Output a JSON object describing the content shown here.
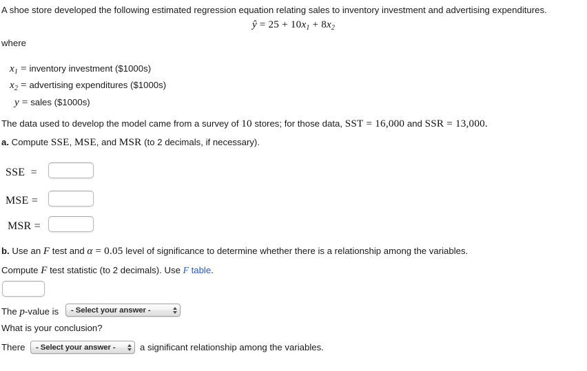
{
  "intro": {
    "prompt": "A shoe store developed the following estimated regression equation relating sales to inventory investment and advertising expenditures.",
    "equation": {
      "lhs": "ŷ",
      "eq": "=",
      "rhs_const": "25",
      "plus1": "+",
      "coef1": "10",
      "var1": "x",
      "sub1": "1",
      "plus2": "+",
      "coef2": "8",
      "var2": "x",
      "sub2": "2",
      "full": "ŷ = 25 + 10x₁ + 8x₂"
    },
    "where_label": "where"
  },
  "definitions": [
    {
      "symbol": "x",
      "subscript": "1",
      "eq": "=",
      "text": "inventory investment ($1000s)"
    },
    {
      "symbol": "x",
      "subscript": "2",
      "eq": "=",
      "text": "advertising expenditures ($1000s)"
    },
    {
      "symbol": "y",
      "subscript": "",
      "eq": "=",
      "text": "sales ($1000s)"
    }
  ],
  "data_sentence": {
    "part1": "The data used to develop the model came from a survey of ",
    "n_stores": "10",
    "part2": " stores; for those data, ",
    "sst_label": "SST",
    "sst_eq": "=",
    "sst_value": "16,000",
    "and": "and",
    "ssr_label": "SSR",
    "ssr_eq": "=",
    "ssr_value": "13,000",
    "period": "."
  },
  "part_a": {
    "marker": "a.",
    "text_before": "Compute ",
    "term1": "SSE",
    "sep1": ", ",
    "term2": "MSE",
    "sep2": ", and ",
    "term3": "MSR",
    "text_after": " (to 2 decimals, if necessary).",
    "fields": [
      {
        "label": "SSE",
        "eq": "=",
        "value": "",
        "placeholder": ""
      },
      {
        "label": "MSE",
        "eq": "=",
        "value": "",
        "placeholder": ""
      },
      {
        "label": "MSR",
        "eq": "=",
        "value": "",
        "placeholder": ""
      }
    ]
  },
  "part_b": {
    "marker": "b.",
    "line1_a": "Use an ",
    "line1_F": "F",
    "line1_b": " test and ",
    "line1_alpha": "α",
    "line1_eq": "=",
    "line1_alpha_value": "0.05",
    "line1_c": " level of significance to determine whether there is a relationship among the variables.",
    "line2_a": "Compute ",
    "line2_F": "F",
    "line2_b": " test statistic (to 2 decimals). Use ",
    "link_F": "F",
    "link_text": " table",
    "line2_c": ".",
    "f_statistic_value": "",
    "pvalue_label_a": "The ",
    "pvalue_label_p": "p",
    "pvalue_label_b": "-value is",
    "pvalue_select": "- Select your answer -",
    "conclusion_question": "What is your conclusion?",
    "conclusion_prefix": "There",
    "conclusion_select": "- Select your answer -",
    "conclusion_suffix": "a significant relationship among the variables."
  },
  "colors": {
    "link": "#2b58c9",
    "text": "#1a1a1a",
    "field_border": "#b9b9b9"
  }
}
